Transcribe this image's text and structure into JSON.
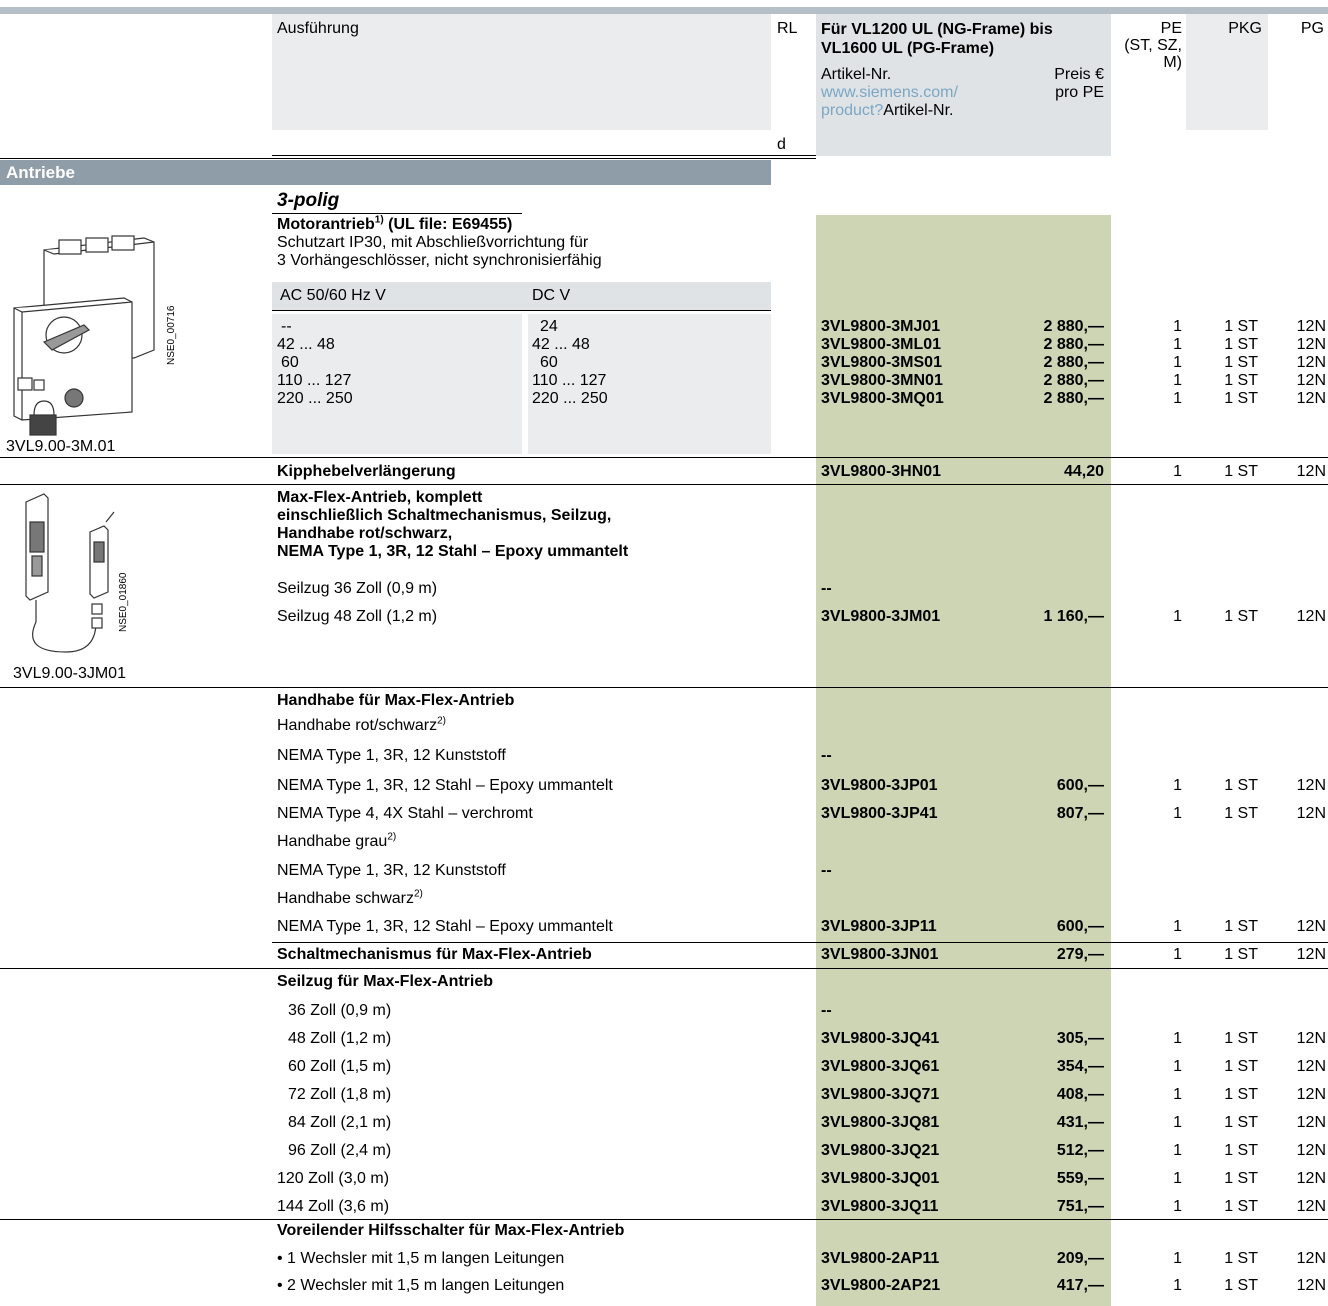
{
  "header": {
    "ausfuehrung": "Ausführung",
    "rl": "RL",
    "rl_sub": "d",
    "vl_title_1": "Für VL1200 UL (NG-Frame) bis",
    "vl_title_2": "VL1600 UL (PG-Frame)",
    "artikel": "Artikel-Nr.",
    "link1": "www.siemens.com/",
    "link2": "product?",
    "link3": "Artikel-Nr.",
    "preis1": "Preis €",
    "preis2": "pro PE",
    "pe1": "PE",
    "pe2": "(ST, SZ,",
    "pe3": "M)",
    "pkg": "PKG",
    "pg": "PG"
  },
  "section": "Antriebe",
  "subsection": "3-polig",
  "motor": {
    "title": "Motorantrieb",
    "sup": "1)",
    "title_rest": " (UL file: E69455)",
    "desc1": "Schutzart IP30, mit Abschließvorrichtung für",
    "desc2": "3 Vorhängeschlösser, nicht synchronisierfähig",
    "col_ac": "AC 50/60 Hz V",
    "col_dc": "DC V",
    "image_label": "3VL9.00-3M.01",
    "image_code": "NSE0_00716",
    "rows": [
      {
        "ac": "--",
        "dc": "24",
        "art": "3VL9800-3MJ01",
        "price": "2 880,—",
        "pe": "1",
        "pkg": "1 ST",
        "pg": "12N"
      },
      {
        "ac": "42 ... 48",
        "dc": "42 ... 48",
        "art": "3VL9800-3ML01",
        "price": "2 880,—",
        "pe": "1",
        "pkg": "1 ST",
        "pg": "12N"
      },
      {
        "ac": "60",
        "dc": "60",
        "art": "3VL9800-3MS01",
        "price": "2 880,—",
        "pe": "1",
        "pkg": "1 ST",
        "pg": "12N"
      },
      {
        "ac": "110 ... 127",
        "dc": "110 ... 127",
        "art": "3VL9800-3MN01",
        "price": "2 880,—",
        "pe": "1",
        "pkg": "1 ST",
        "pg": "12N"
      },
      {
        "ac": "220 ... 250",
        "dc": "220 ... 250",
        "art": "3VL9800-3MQ01",
        "price": "2 880,—",
        "pe": "1",
        "pkg": "1 ST",
        "pg": "12N"
      }
    ]
  },
  "kipp": {
    "label": "Kipphebelverlängerung",
    "art": "3VL9800-3HN01",
    "price": "44,20",
    "pe": "1",
    "pkg": "1 ST",
    "pg": "12N"
  },
  "maxflex": {
    "t1": "Max-Flex-Antrieb, komplett",
    "t2": "einschließlich Schaltmechanismus, Seilzug,",
    "t3": "Handhabe rot/schwarz,",
    "t4": "NEMA Type 1, 3R, 12 Stahl – Epoxy ummantelt",
    "image_label": "3VL9.00-3JM01",
    "image_code": "NSE0_01860",
    "r1": {
      "label": "Seilzug 36 Zoll (0,9 m)",
      "art": "--"
    },
    "r2": {
      "label": "Seilzug 48 Zoll (1,2 m)",
      "art": "3VL9800-3JM01",
      "price": "1 160,—",
      "pe": "1",
      "pkg": "1 ST",
      "pg": "12N"
    }
  },
  "handhabe": {
    "title": "Handhabe für Max-Flex-Antrieb",
    "rows": [
      {
        "label": "Handhabe rot/schwarz",
        "sup": "2)"
      },
      {
        "label": "NEMA Type 1, 3R, 12 Kunststoff",
        "art": "--"
      },
      {
        "label": "NEMA Type 1, 3R, 12 Stahl – Epoxy ummantelt",
        "art": "3VL9800-3JP01",
        "price": "600,—",
        "pe": "1",
        "pkg": "1 ST",
        "pg": "12N"
      },
      {
        "label": "NEMA Type 4, 4X Stahl – verchromt",
        "art": "3VL9800-3JP41",
        "price": "807,—",
        "pe": "1",
        "pkg": "1 ST",
        "pg": "12N"
      },
      {
        "label": "Handhabe grau",
        "sup": "2)"
      },
      {
        "label": "NEMA Type 1, 3R, 12 Kunststoff",
        "art": "--"
      },
      {
        "label": "Handhabe schwarz",
        "sup": "2)"
      },
      {
        "label": "NEMA Type 1, 3R, 12 Stahl – Epoxy ummantelt",
        "art": "3VL9800-3JP11",
        "price": "600,—",
        "pe": "1",
        "pkg": "1 ST",
        "pg": "12N"
      }
    ]
  },
  "schalt": {
    "label": "Schaltmechanismus für Max-Flex-Antrieb",
    "art": "3VL9800-3JN01",
    "price": "279,—",
    "pe": "1",
    "pkg": "1 ST",
    "pg": "12N"
  },
  "seilzug": {
    "title": "Seilzug für Max-Flex-Antrieb",
    "rows": [
      {
        "label": " 36 Zoll (0,9 m)",
        "art": "--"
      },
      {
        "label": " 48 Zoll (1,2 m)",
        "art": "3VL9800-3JQ41",
        "price": "305,—",
        "pe": "1",
        "pkg": "1 ST",
        "pg": "12N"
      },
      {
        "label": " 60 Zoll (1,5 m)",
        "art": "3VL9800-3JQ61",
        "price": "354,—",
        "pe": "1",
        "pkg": "1 ST",
        "pg": "12N"
      },
      {
        "label": " 72 Zoll (1,8 m)",
        "art": "3VL9800-3JQ71",
        "price": "408,—",
        "pe": "1",
        "pkg": "1 ST",
        "pg": "12N"
      },
      {
        "label": " 84 Zoll (2,1 m)",
        "art": "3VL9800-3JQ81",
        "price": "431,—",
        "pe": "1",
        "pkg": "1 ST",
        "pg": "12N"
      },
      {
        "label": " 96 Zoll (2,4 m)",
        "art": "3VL9800-3JQ21",
        "price": "512,—",
        "pe": "1",
        "pkg": "1 ST",
        "pg": "12N"
      },
      {
        "label": "120 Zoll (3,0 m)",
        "art": "3VL9800-3JQ01",
        "price": "559,—",
        "pe": "1",
        "pkg": "1 ST",
        "pg": "12N"
      },
      {
        "label": "144 Zoll (3,6 m)",
        "art": "3VL9800-3JQ11",
        "price": "751,—",
        "pe": "1",
        "pkg": "1 ST",
        "pg": "12N"
      }
    ]
  },
  "vorei": {
    "title": "Voreilender Hilfsschalter für Max-Flex-Antrieb",
    "rows": [
      {
        "label": "• 1 Wechsler mit 1,5 m langen Leitungen",
        "art": "3VL9800-2AP11",
        "price": "209,—",
        "pe": "1",
        "pkg": "1 ST",
        "pg": "12N"
      },
      {
        "label": "• 2 Wechsler mit 1,5 m langen Leitungen",
        "art": "3VL9800-2AP21",
        "price": "417,—",
        "pe": "1",
        "pkg": "1 ST",
        "pg": "12N"
      }
    ]
  }
}
